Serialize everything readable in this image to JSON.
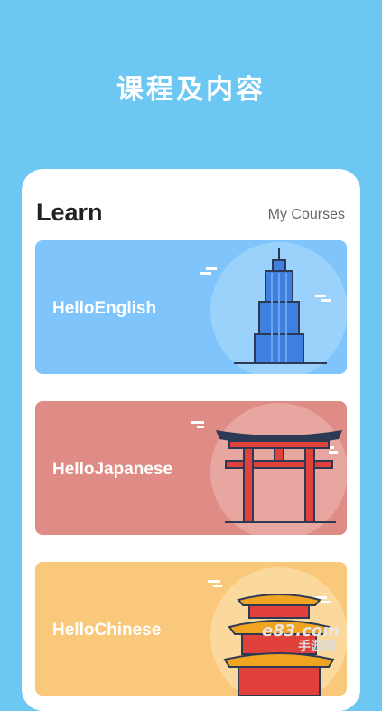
{
  "hero": {
    "title": "课程及内容"
  },
  "header": {
    "title": "Learn",
    "my_courses_label": "My Courses"
  },
  "courses": [
    {
      "label": "HelloEnglish",
      "color": "#7fc4fb",
      "icon": "skyscraper-icon"
    },
    {
      "label": "HelloJapanese",
      "color": "#df8c86",
      "icon": "torii-gate-icon"
    },
    {
      "label": "HelloChinese",
      "color": "#f9c87b",
      "icon": "pagoda-icon"
    }
  ],
  "watermark": {
    "text": "e83.com",
    "subtext": "手游网"
  },
  "colors": {
    "background": "#6cc7f3",
    "card_english": "#7fc4fb",
    "card_japanese": "#df8c86",
    "card_chinese": "#f9c87b"
  }
}
